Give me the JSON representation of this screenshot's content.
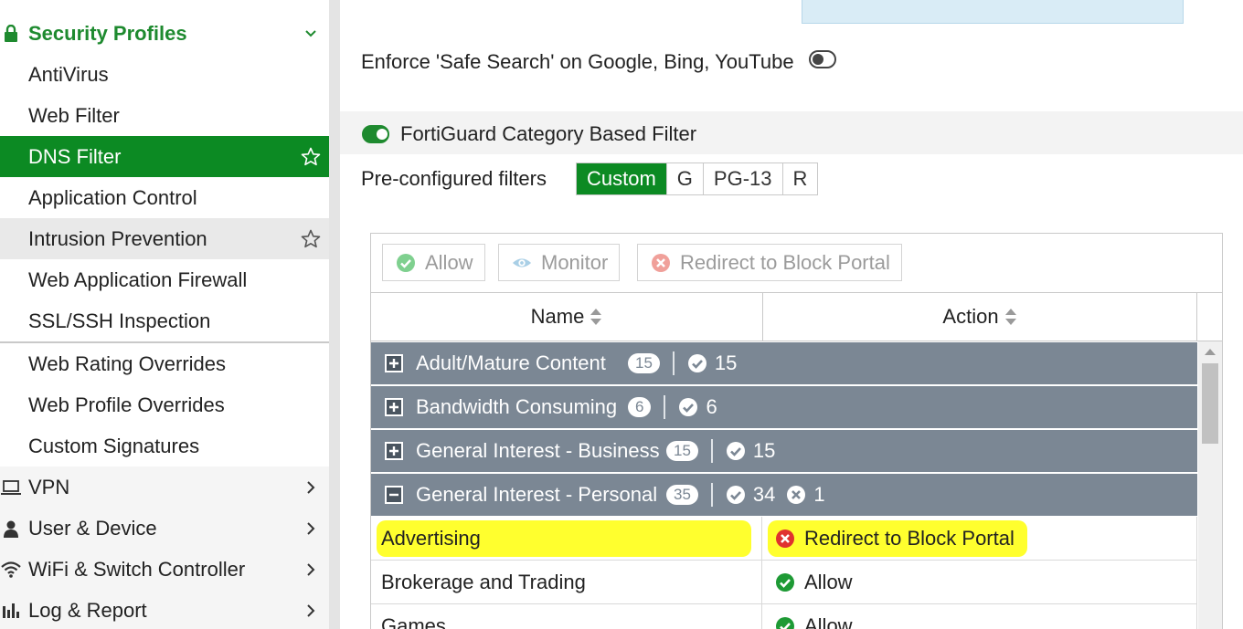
{
  "sidebar": {
    "section": {
      "label": "Security Profiles",
      "icon": "lock-icon"
    },
    "items": [
      {
        "label": "AntiVirus"
      },
      {
        "label": "Web Filter"
      },
      {
        "label": "DNS Filter",
        "active": true
      },
      {
        "label": "Application Control"
      },
      {
        "label": "Intrusion Prevention",
        "hover": true
      },
      {
        "label": "Web Application Firewall"
      },
      {
        "label": "SSL/SSH Inspection"
      },
      {
        "label": "Web Rating Overrides"
      },
      {
        "label": "Web Profile Overrides"
      },
      {
        "label": "Custom Signatures"
      }
    ],
    "menus": [
      {
        "label": "VPN",
        "icon": "laptop-icon"
      },
      {
        "label": "User & Device",
        "icon": "user-icon"
      },
      {
        "label": "WiFi & Switch Controller",
        "icon": "wifi-icon"
      },
      {
        "label": "Log & Report",
        "icon": "bar-chart-icon"
      }
    ]
  },
  "main": {
    "safe_search": {
      "label": "Enforce 'Safe Search' on Google, Bing, YouTube",
      "enabled": false
    },
    "fortiguard": {
      "label": "FortiGuard Category Based Filter",
      "enabled": true
    },
    "preconfig": {
      "label": "Pre-configured filters",
      "options": [
        "Custom",
        "G",
        "PG-13",
        "R"
      ],
      "selected": "Custom"
    },
    "toolbar": {
      "allow": "Allow",
      "monitor": "Monitor",
      "redirect": "Redirect to Block Portal"
    },
    "table": {
      "columns": [
        "Name",
        "Action"
      ],
      "groups": [
        {
          "name": "Adult/Mature Content",
          "total": "15",
          "allowed": "15",
          "blocked": "",
          "expanded": false
        },
        {
          "name": "Bandwidth Consuming",
          "total": "6",
          "allowed": "6",
          "blocked": "",
          "expanded": false
        },
        {
          "name": "General Interest - Business",
          "total": "15",
          "allowed": "15",
          "blocked": "",
          "expanded": false
        },
        {
          "name": "General Interest - Personal",
          "total": "35",
          "allowed": "34",
          "blocked": "1",
          "expanded": true
        }
      ],
      "rows": [
        {
          "name": "Advertising",
          "action": "Redirect to Block Portal",
          "status": "block",
          "highlighted": true
        },
        {
          "name": "Brokerage and Trading",
          "action": "Allow",
          "status": "allow"
        },
        {
          "name": "Games",
          "action": "Allow",
          "status": "allow"
        }
      ]
    }
  },
  "colors": {
    "brand_green": "#0c8a23",
    "group_header": "#7b8794",
    "block_red": "#e0312f",
    "allow_green": "#1e9a35",
    "highlight": "#ffff2e"
  }
}
